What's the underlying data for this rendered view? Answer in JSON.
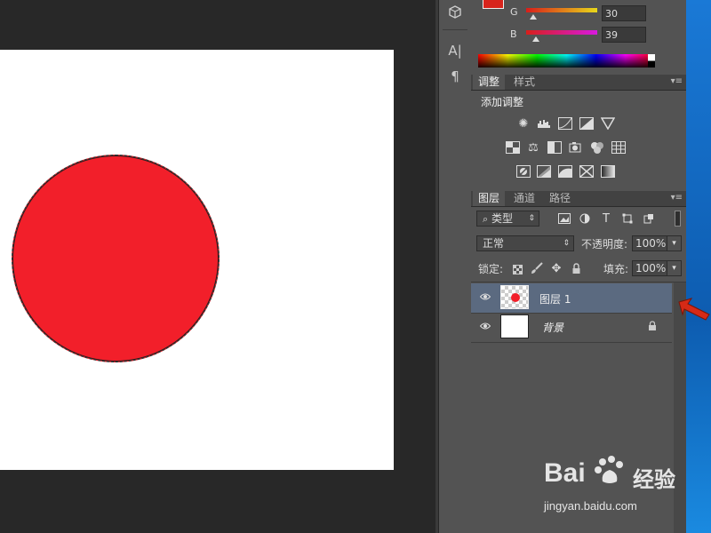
{
  "app": {
    "name": "Photoshop"
  },
  "colors": {
    "fill_red": "#f21f2a",
    "panel_bg": "#535353",
    "selected_layer_bg": "#5b6a80",
    "arrow_red": "#d62a16"
  },
  "color_panel": {
    "channels": [
      {
        "label": "G",
        "value": "30"
      },
      {
        "label": "B",
        "value": "39"
      }
    ]
  },
  "adjustments_panel": {
    "tabs": [
      "调整",
      "样式"
    ],
    "heading": "添加调整",
    "icon_rows": [
      [
        "brightness-icon",
        "levels-icon",
        "curves-icon",
        "exposure-icon",
        "vibrance-icon"
      ],
      [
        "hue-saturation-icon",
        "color-balance-icon",
        "black-white-icon",
        "photo-filter-icon",
        "channel-mixer-icon",
        "color-lookup-icon"
      ],
      [
        "invert-icon",
        "posterize-icon",
        "threshold-icon",
        "selective-color-icon",
        "gradient-map-icon"
      ]
    ]
  },
  "layers_panel": {
    "tabs": [
      "图层",
      "通道",
      "路径"
    ],
    "filter": {
      "search_icon": "search-icon",
      "label": "类型"
    },
    "blend_mode": "正常",
    "opacity": {
      "label": "不透明度:",
      "value": "100%"
    },
    "lock": {
      "label": "锁定:"
    },
    "fill": {
      "label": "填充:",
      "value": "100%"
    },
    "layers": [
      {
        "name": "图层 1",
        "selected": true,
        "locked": false
      },
      {
        "name": "背景",
        "selected": false,
        "locked": true
      }
    ]
  },
  "watermark": {
    "brand": "Bai",
    "brand2": "经验",
    "url": "jingyan.baidu.com"
  }
}
